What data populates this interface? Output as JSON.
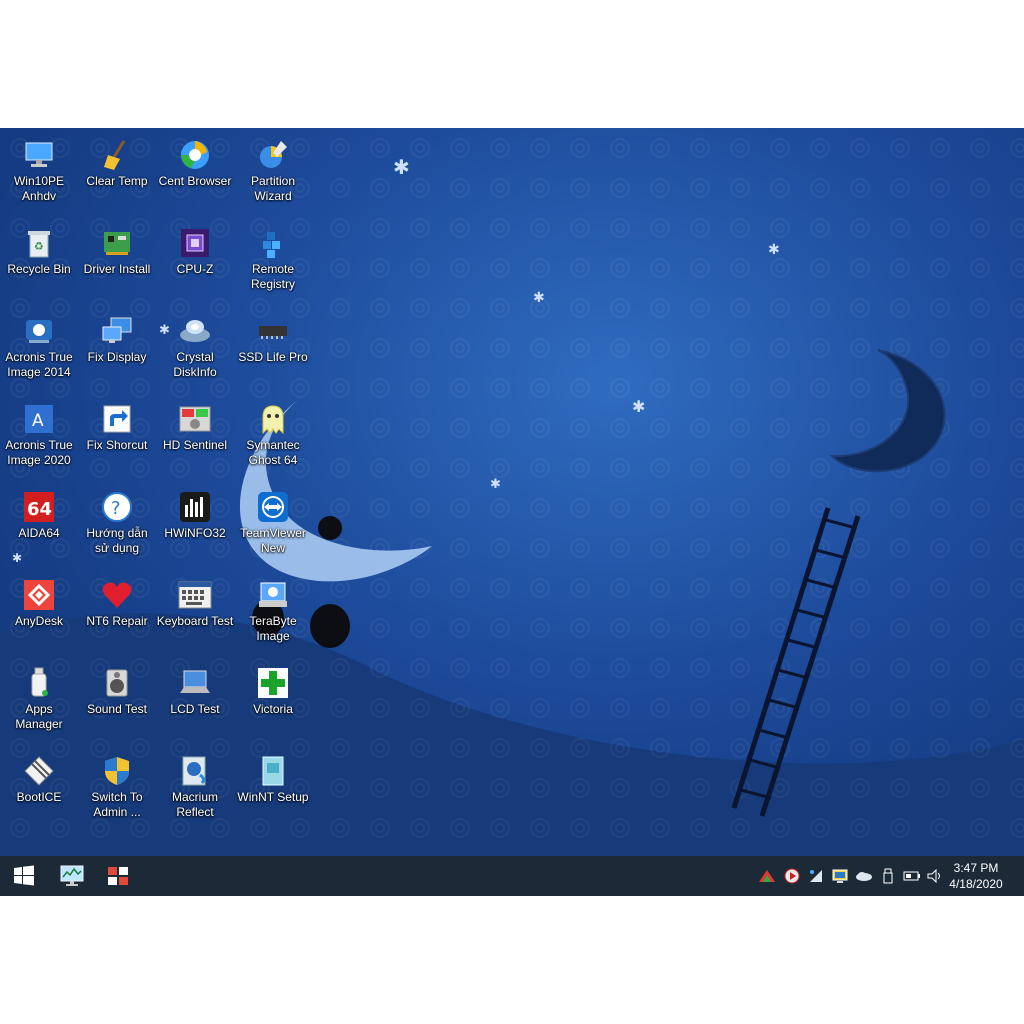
{
  "desktop": {
    "icons": [
      {
        "label": "Win10PE\nAnhdv",
        "icon": "computer-icon"
      },
      {
        "label": "Clear Temp",
        "icon": "broom-icon"
      },
      {
        "label": "Cent Browser",
        "icon": "browser-icon"
      },
      {
        "label": "Partition\nWizard",
        "icon": "partition-icon"
      },
      {
        "label": "Recycle Bin",
        "icon": "recycle-bin-icon"
      },
      {
        "label": "Driver Install",
        "icon": "driver-icon"
      },
      {
        "label": "CPU-Z",
        "icon": "cpu-icon"
      },
      {
        "label": "Remote\nRegistry",
        "icon": "registry-icon"
      },
      {
        "label": "Acronis True\nImage 2014",
        "icon": "acronis-icon"
      },
      {
        "label": "Fix Display",
        "icon": "display-icon"
      },
      {
        "label": "Crystal\nDiskInfo",
        "icon": "disk-info-icon"
      },
      {
        "label": "SSD Life Pro",
        "icon": "ssd-icon"
      },
      {
        "label": "Acronis True\nImage 2020",
        "icon": "acronis-2020-icon"
      },
      {
        "label": "Fix Shorcut",
        "icon": "shortcut-icon"
      },
      {
        "label": "HD Sentinel",
        "icon": "hd-sentinel-icon"
      },
      {
        "label": "Symantec\nGhost 64",
        "icon": "ghost-icon"
      },
      {
        "label": "AIDA64",
        "icon": "aida64-icon"
      },
      {
        "label": "Hướng dẫn\nsử dụng",
        "icon": "help-icon"
      },
      {
        "label": "HWiNFO32",
        "icon": "hwinfo-icon"
      },
      {
        "label": "TeamViewer\nNew",
        "icon": "teamviewer-icon"
      },
      {
        "label": "AnyDesk",
        "icon": "anydesk-icon"
      },
      {
        "label": "NT6 Repair",
        "icon": "heart-icon"
      },
      {
        "label": "Keyboard Test",
        "icon": "keyboard-icon"
      },
      {
        "label": "TeraByte\nImage",
        "icon": "terabyte-icon"
      },
      {
        "label": "Apps\nManager",
        "icon": "usb-icon"
      },
      {
        "label": "Sound Test",
        "icon": "speaker-icon"
      },
      {
        "label": "LCD Test",
        "icon": "laptop-icon"
      },
      {
        "label": "Victoria",
        "icon": "green-cross-icon"
      },
      {
        "label": "BootICE",
        "icon": "bootice-icon"
      },
      {
        "label": "Switch To\nAdmin ...",
        "icon": "shield-icon"
      },
      {
        "label": "Macrium\nReflect",
        "icon": "macrium-icon"
      },
      {
        "label": "WinNT Setup",
        "icon": "setup-icon"
      }
    ]
  },
  "taskbar": {
    "start_icon": "windows-logo-icon",
    "pinned": [
      {
        "icon": "network-monitor-icon"
      },
      {
        "icon": "windows-tiles-icon"
      }
    ],
    "tray": [
      {
        "icon": "triangle-tray-icon"
      },
      {
        "icon": "media-play-icon"
      },
      {
        "icon": "sparkle-tray-icon"
      },
      {
        "icon": "display-tray-icon"
      },
      {
        "icon": "cloud-tray-icon"
      },
      {
        "icon": "usb-tray-icon"
      },
      {
        "icon": "battery-icon"
      },
      {
        "icon": "volume-icon"
      }
    ],
    "time": "3:47 PM",
    "date": "4/18/2020"
  },
  "colors": {
    "wallpaper": "#1d4a9a",
    "taskbar": "#1c2a38",
    "label_text": "#ffffff"
  }
}
